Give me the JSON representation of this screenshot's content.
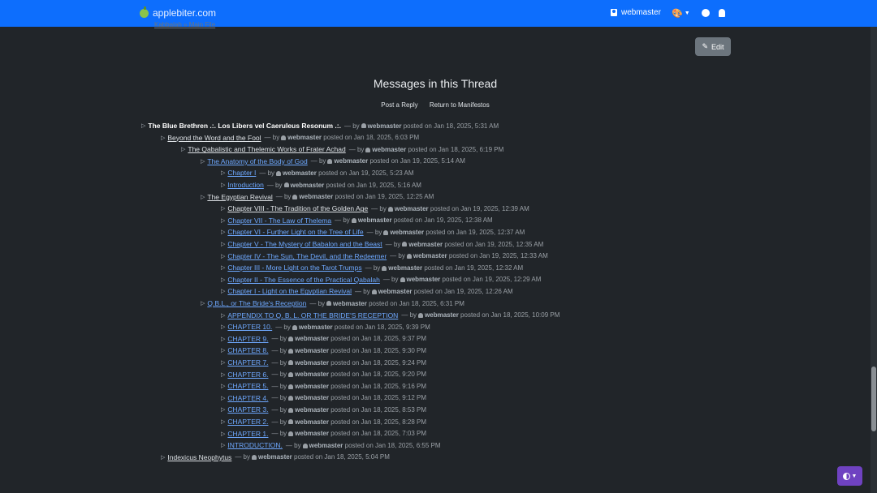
{
  "navbar": {
    "brand": "applebiter.com",
    "user": "webmaster"
  },
  "breadcrumb_fragment": "Kabbalah » Main File",
  "edit_label": "Edit",
  "thread": {
    "title": "Messages in this Thread",
    "post_reply": "Post a Reply",
    "return_link": "Return to Manifestos"
  },
  "rows": [
    {
      "title": "The Blue Brethren .:. Los Libers vel Caeruleus Resonum .:.",
      "style": "bold",
      "level": 0,
      "author": "webmaster",
      "date": "posted on Jan 18, 2025, 5:31 AM"
    },
    {
      "title": "Beyond the Word and the Fool",
      "style": "visited",
      "level": 1,
      "author": "webmaster",
      "date": "posted on Jan 18, 2025, 6:03 PM"
    },
    {
      "title": "The Qabalistic and Thelemic Works of Frater Achad",
      "style": "visited",
      "level": 2,
      "author": "webmaster",
      "date": "posted on Jan 18, 2025, 6:19 PM"
    },
    {
      "title": "The Anatomy of the Body of God",
      "style": "link",
      "level": 3,
      "author": "webmaster",
      "date": "posted on Jan 19, 2025, 5:14 AM"
    },
    {
      "title": "Chapter I",
      "style": "link",
      "level": 4,
      "author": "webmaster",
      "date": "posted on Jan 19, 2025, 5:23 AM"
    },
    {
      "title": "Introduction",
      "style": "link",
      "level": 4,
      "author": "webmaster",
      "date": "posted on Jan 19, 2025, 5:16 AM"
    },
    {
      "title": "The Egyptian Revival",
      "style": "visited",
      "level": 3,
      "author": "webmaster",
      "date": "posted on Jan 19, 2025, 12:25 AM"
    },
    {
      "title": "Chapter VIII - The Tradition of the Golden Age",
      "style": "visited",
      "level": 4,
      "author": "webmaster",
      "date": "posted on Jan 19, 2025, 12:39 AM"
    },
    {
      "title": "Chapter VII - The Law of Thelema",
      "style": "link",
      "level": 4,
      "author": "webmaster",
      "date": "posted on Jan 19, 2025, 12:38 AM"
    },
    {
      "title": "Chapter VI - Further Light on the Tree of Life",
      "style": "link",
      "level": 4,
      "author": "webmaster",
      "date": "posted on Jan 19, 2025, 12:37 AM"
    },
    {
      "title": "Chapter V - The Mystery of Babalon and the Beast",
      "style": "link",
      "level": 4,
      "author": "webmaster",
      "date": "posted on Jan 19, 2025, 12:35 AM"
    },
    {
      "title": "Chapter IV - The Sun, The Devil, and the Redeemer",
      "style": "link",
      "level": 4,
      "author": "webmaster",
      "date": "posted on Jan 19, 2025, 12:33 AM"
    },
    {
      "title": "Chapter III - More Light on the Tarot Trumps",
      "style": "link",
      "level": 4,
      "author": "webmaster",
      "date": "posted on Jan 19, 2025, 12:32 AM"
    },
    {
      "title": "Chapter II - The Essence of the Practical Qabalah",
      "style": "link",
      "level": 4,
      "author": "webmaster",
      "date": "posted on Jan 19, 2025, 12:29 AM"
    },
    {
      "title": "Chapter I - Light on the Egyptian Revival",
      "style": "link",
      "level": 4,
      "author": "webmaster",
      "date": "posted on Jan 19, 2025, 12:26 AM"
    },
    {
      "title": "Q.B.L., or The Bride's Reception",
      "style": "link",
      "level": 3,
      "author": "webmaster",
      "date": "posted on Jan 18, 2025, 6:31 PM"
    },
    {
      "title": "APPENDIX TO Q. B. L. OR THE BRIDE'S RECEPTION",
      "style": "link",
      "level": 4,
      "author": "webmaster",
      "date": "posted on Jan 18, 2025, 10:09 PM"
    },
    {
      "title": "CHAPTER 10.",
      "style": "link",
      "level": 4,
      "author": "webmaster",
      "date": "posted on Jan 18, 2025, 9:39 PM"
    },
    {
      "title": "CHAPTER 9.",
      "style": "link",
      "level": 4,
      "author": "webmaster",
      "date": "posted on Jan 18, 2025, 9:37 PM"
    },
    {
      "title": "CHAPTER 8.",
      "style": "link",
      "level": 4,
      "author": "webmaster",
      "date": "posted on Jan 18, 2025, 9:30 PM"
    },
    {
      "title": "CHAPTER 7.",
      "style": "link",
      "level": 4,
      "author": "webmaster",
      "date": "posted on Jan 18, 2025, 9:24 PM"
    },
    {
      "title": "CHAPTER 6.",
      "style": "link",
      "level": 4,
      "author": "webmaster",
      "date": "posted on Jan 18, 2025, 9:20 PM"
    },
    {
      "title": "CHAPTER 5.",
      "style": "link",
      "level": 4,
      "author": "webmaster",
      "date": "posted on Jan 18, 2025, 9:16 PM"
    },
    {
      "title": "CHAPTER 4.",
      "style": "link",
      "level": 4,
      "author": "webmaster",
      "date": "posted on Jan 18, 2025, 9:12 PM"
    },
    {
      "title": "CHAPTER 3.",
      "style": "link",
      "level": 4,
      "author": "webmaster",
      "date": "posted on Jan 18, 2025, 8:53 PM"
    },
    {
      "title": "CHAPTER 2.",
      "style": "link",
      "level": 4,
      "author": "webmaster",
      "date": "posted on Jan 18, 2025, 8:28 PM"
    },
    {
      "title": "CHAPTER 1.",
      "style": "link",
      "level": 4,
      "author": "webmaster",
      "date": "posted on Jan 18, 2025, 7:03 PM"
    },
    {
      "title": "INTRODUCTION.",
      "style": "link",
      "level": 4,
      "author": "webmaster",
      "date": "posted on Jan 18, 2025, 6:55 PM"
    },
    {
      "title": "Indexicus Neophytus",
      "style": "visited",
      "level": 1,
      "author": "webmaster",
      "date": "posted on Jan 18, 2025, 5:04 PM"
    }
  ],
  "meta_by": "by",
  "meta_dash": "—",
  "colors": {
    "navbar": "#0d6efd",
    "link": "#6ea8fe",
    "background": "#212529",
    "theme_button": "#6f42c1"
  },
  "icons": {
    "brand": "apple-icon",
    "user": "user-icon",
    "theme": "palette-icon",
    "github": "github-icon",
    "ghost": "ghost-icon",
    "edit": "pencil-icon",
    "row": "triangle-right-icon",
    "author": "person-icon",
    "toggle": "contrast-icon"
  }
}
